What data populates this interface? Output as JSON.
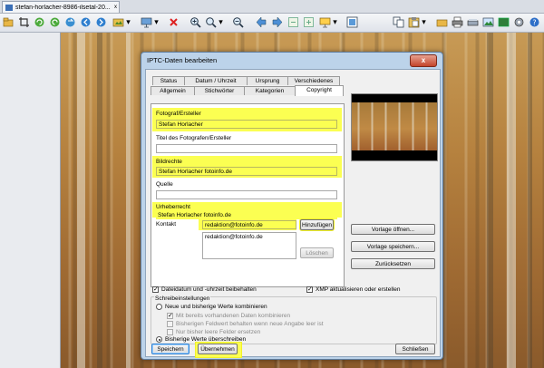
{
  "tabbar": {
    "tab_title": "stefan-horlacher-8986-ilsetal-20...",
    "close_glyph": "x"
  },
  "toolbar": {
    "icons": [
      "open-icon",
      "crop-icon",
      "rotate-left-icon",
      "rotate-right-icon",
      "refresh-icon",
      "back-icon",
      "forward-icon",
      "batch-icon",
      "dropdown-icon",
      "slideshow-icon",
      "dropdown-icon",
      "delete-icon",
      "zoom-in-icon",
      "zoom-icon",
      "zoom-out-icon",
      "arrow-left-icon",
      "arrow-right-icon",
      "first-page-icon",
      "last-page-icon",
      "desktop-icon",
      "dropdown-icon",
      "fullscreen-icon",
      "copy-icon",
      "paste-icon",
      "print-icon",
      "scan-icon",
      "image-icon",
      "settings-icon",
      "help-icon"
    ]
  },
  "dialog": {
    "title": "IPTC-Daten bearbeiten",
    "close_glyph": "x",
    "tabs_row1": [
      "Status",
      "Datum / Uhrzeit",
      "Ursprung",
      "Verschiedenes"
    ],
    "tabs_row2": [
      "Allgemein",
      "Stichwörter",
      "Kategorien",
      "Copyright"
    ],
    "active_tab": "Copyright",
    "fields": {
      "photographer_label": "Fotograf/Ersteller",
      "photographer_value": "Stefan Horlacher",
      "title_label": "Titel des Fotografen/Ersteller",
      "title_value": "",
      "rights_label": "Bildrechte",
      "rights_value": "Stefan Horlacher fotoinfo.de",
      "source_label": "Quelle",
      "source_value": "",
      "copyright_label": "Urheberrecht",
      "copyright_value": "Stefan Horlacher fotoinfo.de",
      "contact_label": "Kontakt",
      "contact_input": "redaktion@fotoinfo.de",
      "contact_list": [
        "redaktion@fotoinfo.de"
      ]
    },
    "buttons": {
      "add": "Hinzufügen",
      "delete": "Löschen",
      "open_template": "Vorlage öffnen...",
      "save_template": "Vorlage speichern...",
      "reset": "Zurücksetzen",
      "save": "Speichern",
      "apply": "Übernehmen",
      "close": "Schließen"
    },
    "options": {
      "keep_date": {
        "label": "Dateidatum und -uhrzeit beibehalten",
        "checked": true
      },
      "xmp": {
        "label": "XMP aktualisieren oder erstellen",
        "checked": true
      }
    },
    "write_settings": {
      "label": "Schreibeinstellungen",
      "radio_combine": "Neue und bisherige Werte kombinieren",
      "cb_combine_existing": "Mit bereits vorhandenen Daten kombinieren",
      "cb_keep_old": "Bisherigen Feldwert behalten wenn neue Angabe leer ist",
      "cb_only_empty": "Nur bisher leere Felder ersetzen",
      "radio_overwrite": "Bisherige Werte überschreiben",
      "selected": "overwrite"
    },
    "colors": {
      "highlight": "#fbff52",
      "title_bg": "#bcd3ea"
    }
  }
}
